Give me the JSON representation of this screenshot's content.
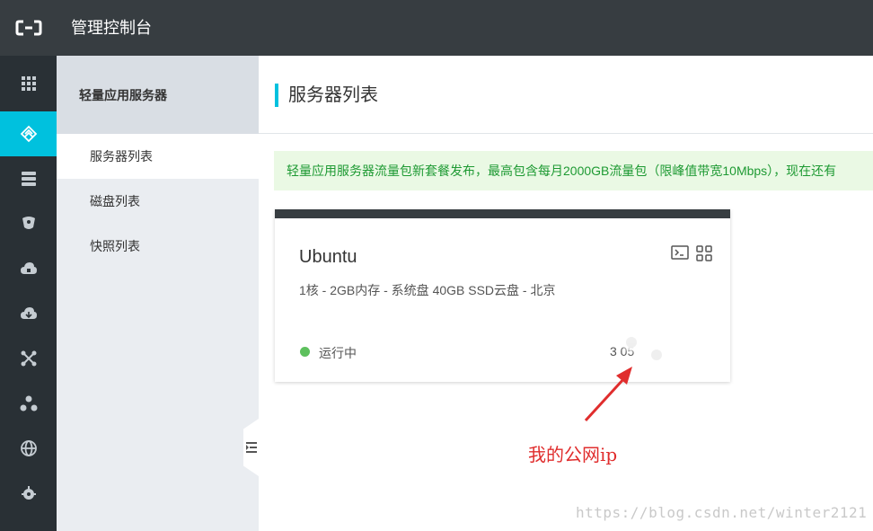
{
  "header": {
    "logo": "aliyun-logo-icon",
    "title": "管理控制台"
  },
  "left_nav": {
    "items": [
      {
        "icon": "apps-grid-icon",
        "active": false
      },
      {
        "icon": "light-server-icon",
        "active": true
      },
      {
        "icon": "server-stack-icon",
        "active": false
      },
      {
        "icon": "database-icon",
        "active": false
      },
      {
        "icon": "cloud-storage-icon",
        "active": false
      },
      {
        "icon": "cloud-sync-icon",
        "active": false
      },
      {
        "icon": "network-cross-icon",
        "active": false
      },
      {
        "icon": "cluster-nodes-icon",
        "active": false
      },
      {
        "icon": "globe-icon",
        "active": false
      },
      {
        "icon": "gear-cloud-icon",
        "active": false
      }
    ],
    "accent_color": "#00c1de"
  },
  "sub_nav": {
    "title": "轻量应用服务器",
    "items": [
      {
        "label": "服务器列表",
        "active": true
      },
      {
        "label": "磁盘列表",
        "active": false
      },
      {
        "label": "快照列表",
        "active": false
      }
    ]
  },
  "main": {
    "title": "服务器列表",
    "notice": "轻量应用服务器流量包新套餐发布，最高包含每月2000GB流量包（限峰值带宽10Mbps），现在还有"
  },
  "server_card": {
    "name": "Ubuntu",
    "spec": "1核 - 2GB内存 - 系统盘 40GB SSD云盘 - 北京",
    "status": "运行中",
    "status_color": "#5dc05d",
    "ip_visible": "3 05",
    "actions": [
      "terminal-icon",
      "app-grid-icon"
    ]
  },
  "annotation": {
    "text": "我的公网ip",
    "color": "#e02d2d"
  },
  "watermark": "https://blog.csdn.net/winter2121"
}
